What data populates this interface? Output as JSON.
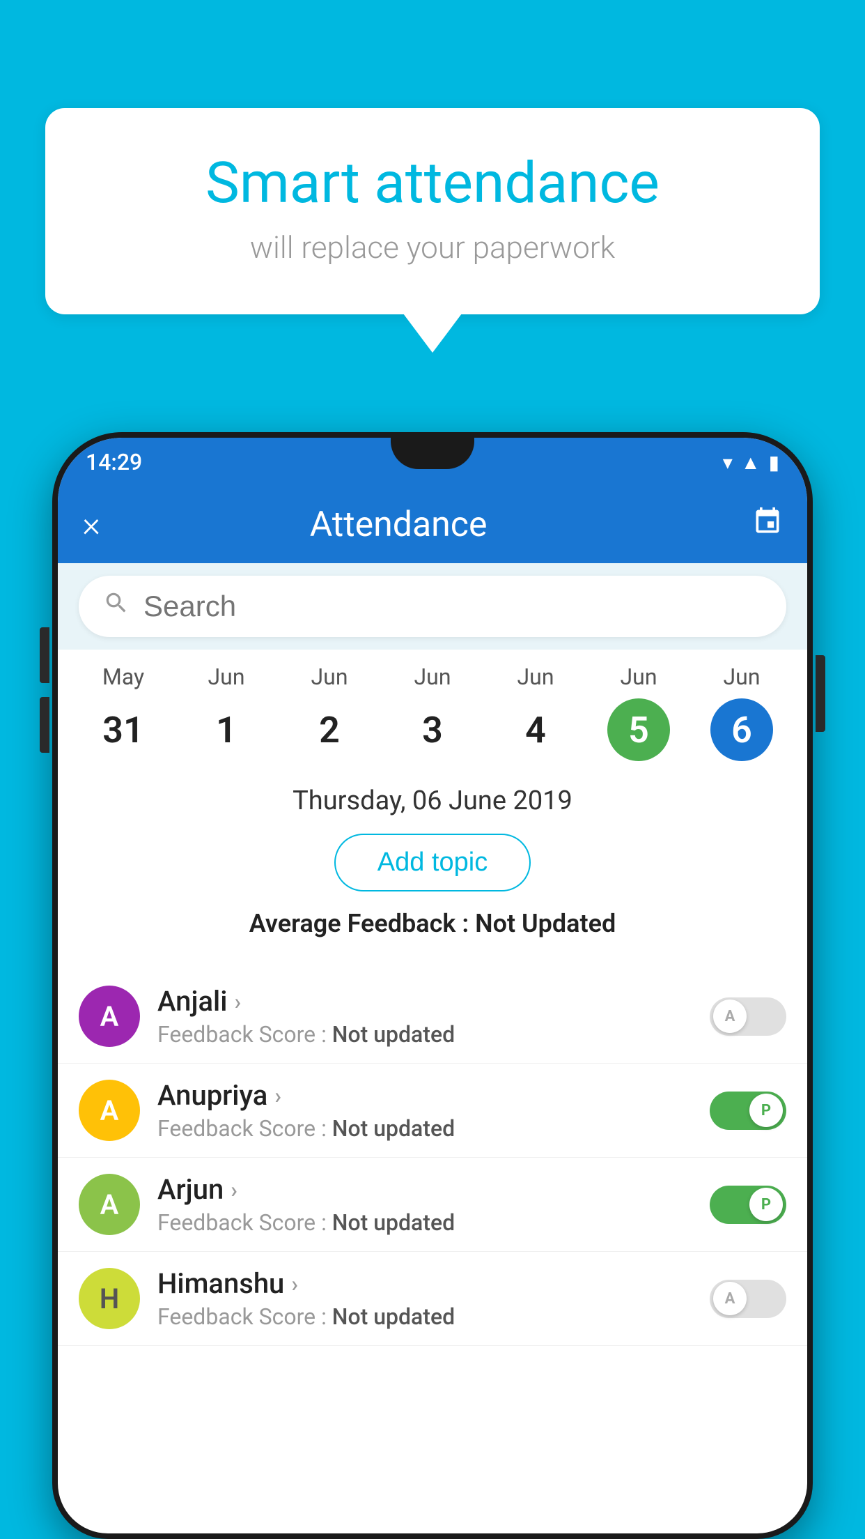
{
  "background_color": "#00b8e0",
  "speech_bubble": {
    "title": "Smart attendance",
    "subtitle": "will replace your paperwork"
  },
  "status_bar": {
    "time": "14:29",
    "icons": [
      "wifi",
      "signal",
      "battery"
    ]
  },
  "app_bar": {
    "title": "Attendance",
    "close_label": "×",
    "calendar_icon": "📅"
  },
  "search": {
    "placeholder": "Search"
  },
  "calendar": {
    "days": [
      {
        "month": "May",
        "date": "31",
        "state": "normal"
      },
      {
        "month": "Jun",
        "date": "1",
        "state": "normal"
      },
      {
        "month": "Jun",
        "date": "2",
        "state": "normal"
      },
      {
        "month": "Jun",
        "date": "3",
        "state": "normal"
      },
      {
        "month": "Jun",
        "date": "4",
        "state": "normal"
      },
      {
        "month": "Jun",
        "date": "5",
        "state": "today"
      },
      {
        "month": "Jun",
        "date": "6",
        "state": "selected"
      }
    ]
  },
  "selected_date": "Thursday, 06 June 2019",
  "add_topic_label": "Add topic",
  "avg_feedback_label": "Average Feedback : ",
  "avg_feedback_value": "Not Updated",
  "students": [
    {
      "name": "Anjali",
      "avatar_letter": "A",
      "avatar_color": "purple",
      "feedback_label": "Feedback Score : ",
      "feedback_value": "Not updated",
      "toggle_state": "off",
      "toggle_label": "A"
    },
    {
      "name": "Anupriya",
      "avatar_letter": "A",
      "avatar_color": "yellow",
      "feedback_label": "Feedback Score : ",
      "feedback_value": "Not updated",
      "toggle_state": "on",
      "toggle_label": "P"
    },
    {
      "name": "Arjun",
      "avatar_letter": "A",
      "avatar_color": "green",
      "feedback_label": "Feedback Score : ",
      "feedback_value": "Not updated",
      "toggle_state": "on",
      "toggle_label": "P"
    },
    {
      "name": "Himanshu",
      "avatar_letter": "H",
      "avatar_color": "lime",
      "feedback_label": "Feedback Score : ",
      "feedback_value": "Not updated",
      "toggle_state": "off",
      "toggle_label": "A"
    }
  ]
}
